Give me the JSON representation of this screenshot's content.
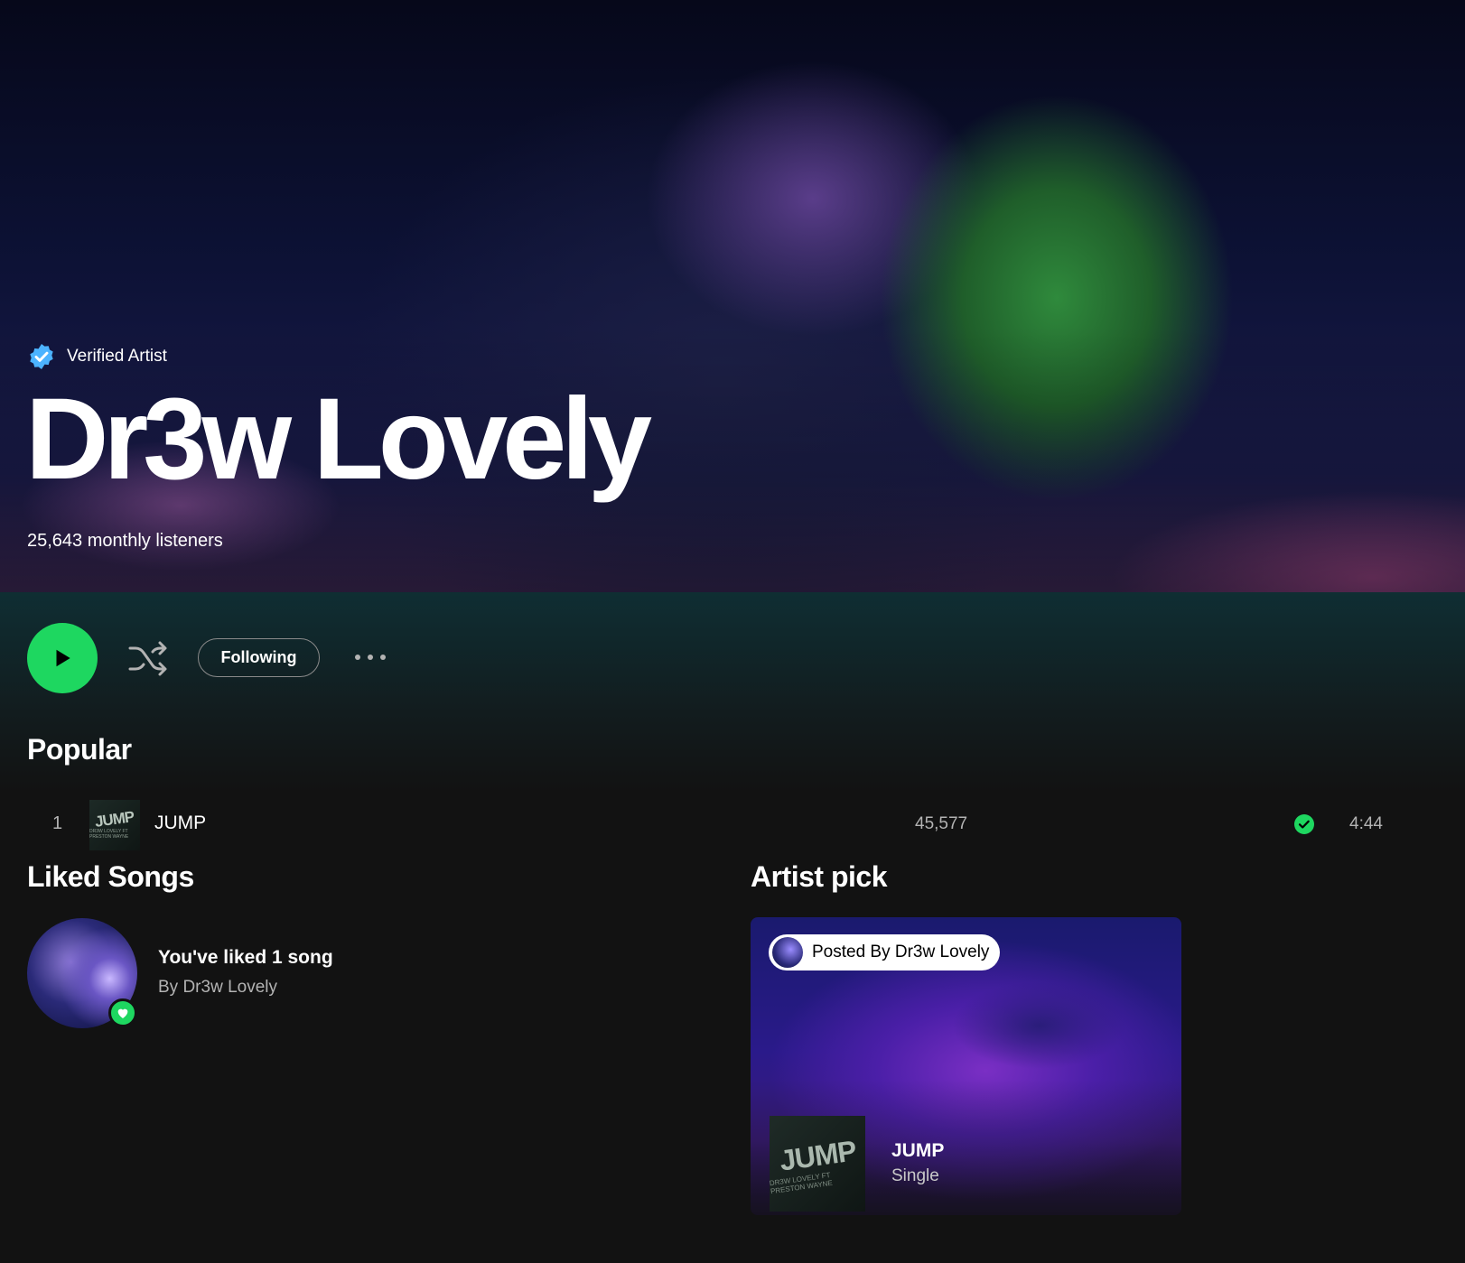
{
  "hero": {
    "verified_label": "Verified Artist",
    "artist_name": "Dr3w Lovely",
    "monthly_listeners": "25,643 monthly listeners"
  },
  "actions": {
    "play_icon": "play-icon",
    "shuffle_icon": "shuffle-icon",
    "following_label": "Following",
    "more_icon": "more-icon"
  },
  "popular": {
    "title": "Popular",
    "tracks": [
      {
        "rank": "1",
        "cover_text": "JUMP",
        "cover_subtext": "DR3W LOVELY FT PRESTON WAYNE",
        "title": "JUMP",
        "plays": "45,577",
        "saved": true,
        "duration": "4:44"
      }
    ]
  },
  "liked_songs": {
    "title": "Liked Songs",
    "summary": "You've liked 1 song",
    "by": "By Dr3w Lovely"
  },
  "artist_pick": {
    "title": "Artist pick",
    "posted_by": "Posted By Dr3w Lovely",
    "cover_text": "JUMP",
    "cover_subtext": "DR3W LOVELY FT PRESTON WAYNE",
    "item_title": "JUMP",
    "item_type": "Single"
  },
  "colors": {
    "accent": "#1ed760",
    "background": "#121212",
    "verified_blue": "#4cb3ff",
    "muted_text": "#b3b3b3"
  }
}
